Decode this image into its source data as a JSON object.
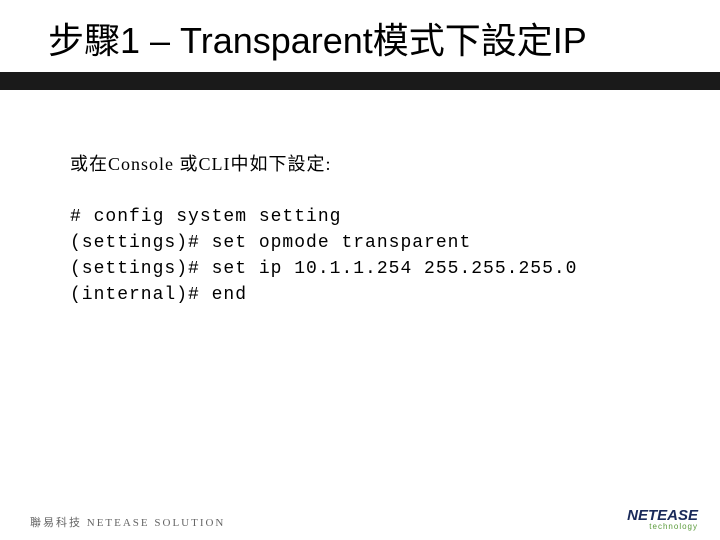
{
  "title": "步驟1 – Transparent模式下設定IP",
  "intro": "或在Console 或CLI中如下設定:",
  "code_lines": [
    "# config system setting",
    "(settings)# set opmode transparent",
    "(settings)# set ip 10.1.1.254 255.255.255.0",
    "(internal)# end"
  ],
  "footer": "聯易科技  NETEASE SOLUTION",
  "logo": {
    "top": "NETEASE",
    "bottom": "technology"
  }
}
